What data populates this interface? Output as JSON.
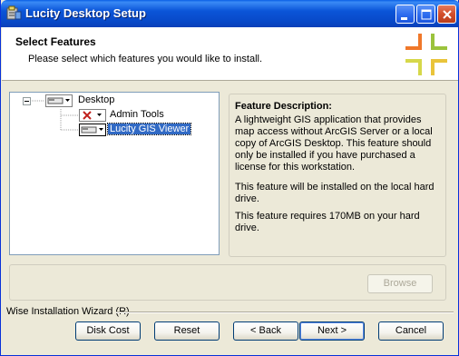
{
  "window": {
    "title": "Lucity Desktop Setup",
    "colors": {
      "titlebar": "#0a5fe6",
      "close": "#d34e2a",
      "face": "#ece9d8"
    }
  },
  "header": {
    "title": "Select Features",
    "subtitle": "Please select which features you would like to install."
  },
  "tree": {
    "items": [
      {
        "label": "Desktop",
        "icon": "drive-dropdown-icon",
        "state": "install"
      },
      {
        "label": "Admin Tools",
        "icon": "x-dropdown-icon",
        "state": "not-installed"
      },
      {
        "label": "Lucity GIS Viewer",
        "icon": "drive-dropdown-icon",
        "state": "install",
        "selected": true
      }
    ]
  },
  "description": {
    "title": "Feature Description:",
    "paragraphs": [
      "A lightweight GIS application that provides map access without ArcGIS Server or a local copy of ArcGIS Desktop. This feature should only be installed if you have purchased a license for this workstation.",
      "This feature will be installed on the local hard drive.",
      "This feature requires 170MB on your hard drive."
    ]
  },
  "buttons": {
    "browse": "Browse",
    "disk_cost": "Disk Cost",
    "reset": "Reset",
    "back": "< Back",
    "next": "Next >",
    "cancel": "Cancel"
  },
  "footer": {
    "wizard": "Wise Installation Wizard (R)"
  }
}
